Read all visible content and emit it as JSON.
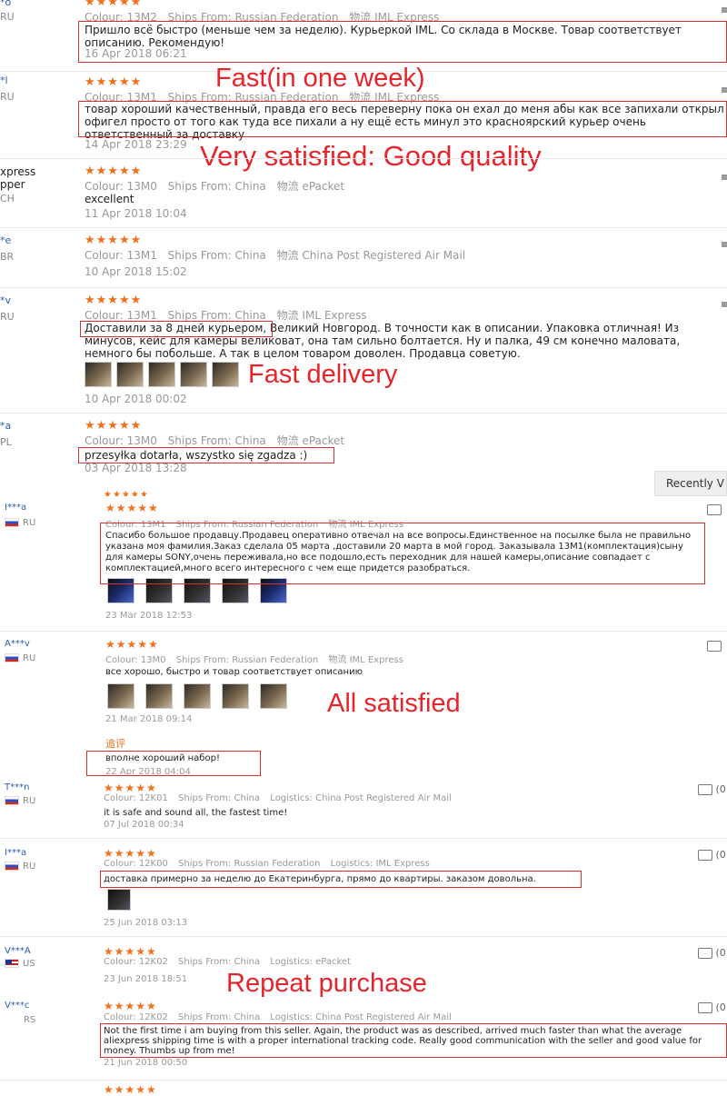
{
  "reviews_top": [
    {
      "buyer": "*o",
      "country": "RU",
      "colour": "Colour: 13M2",
      "ships": "Ships From: Russian Federation",
      "logistics": "物流  IML Express",
      "text": "Пришло всё быстро (меньше чем за неделю). Курьеркой IML. Со склада в Москве. Товар соответствует описанию. Рекомендую!",
      "date": "16 Apr 2018 06:21"
    },
    {
      "buyer": "*l",
      "country": "RU",
      "colour": "Colour: 13M1",
      "ships": "Ships From: Russian Federation",
      "logistics": "物流  IML Express",
      "text": "товар хороший качественный, правда его весь переверну пока он ехал до меня абы как все запихали открыл офигел просто от того как туда все пихали а ну ещё есть минул это красноярский курьер очень ответственный за доставку",
      "date": "14 Apr 2018 23:29"
    },
    {
      "buyer": "xpress\npper",
      "country": "CH",
      "colour": "Colour: 13M0",
      "ships": "Ships From: China",
      "logistics": "物流  ePacket",
      "text": "excellent",
      "date": "11 Apr 2018 10:04"
    },
    {
      "buyer": "*e",
      "country": "BR",
      "colour": "Colour: 13M1",
      "ships": "Ships From: China",
      "logistics": "物流  China Post Registered Air Mail",
      "text": "",
      "date": "10 Apr 2018 15:02"
    },
    {
      "buyer": "*v",
      "country": "RU",
      "colour": "Colour: 13M1",
      "ships": "Ships From: China",
      "logistics": "物流  IML Express",
      "text": "Доставили за 8 дней курьером, Великий Новгород. В точности как в описании. Упаковка отличная! Из минусов, кейс для камеры великоват, она там сильно болтается. Ну и палка, 49 см конечно маловата, немного бы побольше. А так в целом товаром доволен. Продавца советую.",
      "date": "10 Apr 2018 00:02"
    },
    {
      "buyer": "*a",
      "country": "PL",
      "colour": "Colour: 13M0",
      "ships": "Ships From: China",
      "logistics": "物流  ePacket",
      "text": "przesyłka dotarła, wszystko się zgadza :)",
      "date": "03 Apr 2018 13:28"
    }
  ],
  "reviews_mid": [
    {
      "buyer": "I***a",
      "country": "RU",
      "colour": "Colour: 13M1",
      "ships": "Ships From: Russian Federation",
      "logistics": "物流  IML Express",
      "text": "Спасибо большое продавцу.Продавец оперативно отвечал на все вопросы.Единственное на посылке была не правильно указана моя фамилия.Заказ сделала 05 марта ,доставили 20 марта в мой город. Заказывала 13M1(комплектация)сыну для камеры SONY,очень переживала,но все подошло,есть переходник для нашей камеры,описание совпадает с комплектацией,много всего интересного с чем еще придется разобраться.",
      "date": "23 Mar 2018 12:53"
    },
    {
      "buyer": "A***v",
      "country": "RU",
      "colour": "Colour: 13M0",
      "ships": "Ships From: Russian Federation",
      "logistics": "物流  IML Express",
      "text": "все хорошо, быстро и товар соответствует описанию",
      "date": "21 Mar 2018 09:14",
      "followup_label": "追评",
      "followup_text": "вполне хороший набор!",
      "followup_date": "22 Apr 2018 04:04"
    }
  ],
  "reviews_bottom": [
    {
      "buyer": "T***n",
      "country": "RU",
      "colour": "Colour: 12K01",
      "ships": "Ships From: China",
      "logistics": "Logistics: China Post Registered Air Mail",
      "text": "it is safe and sound all, the fastest time!",
      "date": "07 Jul 2018 00:34",
      "helpful": "(0"
    },
    {
      "buyer": "I***a",
      "country": "RU",
      "colour": "Colour: 12K00",
      "ships": "Ships From: Russian Federation",
      "logistics": "Logistics: IML Express",
      "text": "доставка примерно за неделю до Екатеринбурга, прямо до квартиры. заказом довольна.",
      "date": "25 Jun 2018 03:13",
      "helpful": "(0"
    },
    {
      "buyer": "V***A",
      "country": "US",
      "colour": "Colour: 12K02",
      "ships": "Ships From: China",
      "logistics": "Logistics: ePacket",
      "text": "",
      "date": "23 Jun 2018 18:51",
      "helpful": "(0"
    },
    {
      "buyer": "V***c",
      "country": "RS",
      "colour": "Colour: 12K02",
      "ships": "Ships From: China",
      "logistics": "Logistics: China Post Registered Air Mail",
      "text": "Not the first time i am buying from this seller. Again, the product was as described, arrived much faster than what the average aliexpress shipping time is with a proper international tracking code. Really good communication with the seller and good value for money. Thumbs up from me!",
      "date": "21 Jun 2018 00:50",
      "helpful": "(0"
    }
  ],
  "stars": "★★★★★",
  "recently_button": "Recently V",
  "annotations": {
    "fast": "Fast(in one week)",
    "satisfied": "Very satisfied: Good quality",
    "fast_delivery": "Fast delivery",
    "all_satisfied": "All satisfied",
    "repeat": "Repeat purchase"
  },
  "colors": {
    "stars": "#f26f1b",
    "annotation": "#e8242b",
    "box": "#d63030",
    "buyer": "#2a5db0"
  }
}
